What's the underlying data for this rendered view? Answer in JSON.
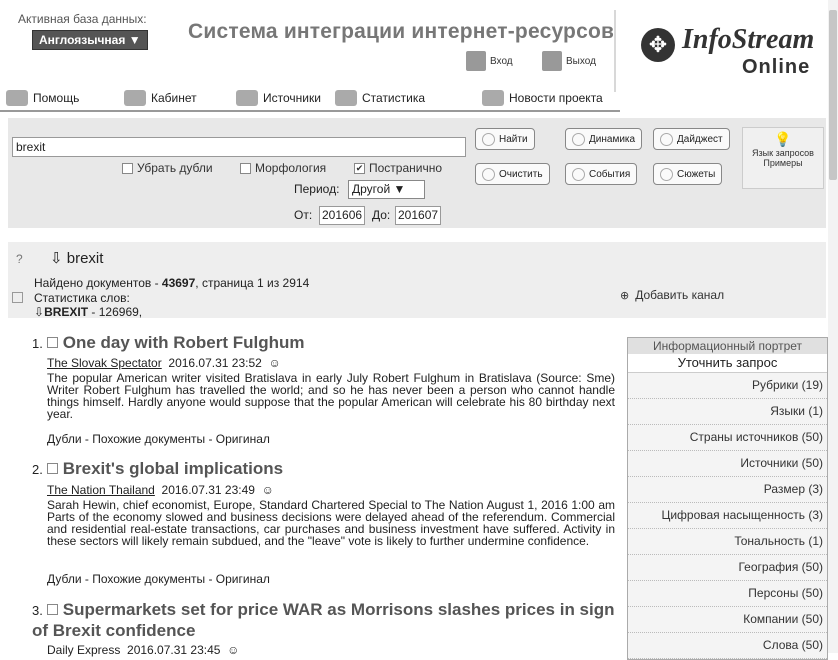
{
  "header": {
    "db_label": "Активная база данных:",
    "db_value": "Англоязычная ▼",
    "title": "Система интеграции интернет-ресурсов",
    "login": "Вход",
    "logout": "Выход",
    "logo_line1": "InfoStream",
    "logo_line2": "Online"
  },
  "nav": [
    "Помощь",
    "Кабинет",
    "Источники",
    "Статистика",
    "Новости проекта"
  ],
  "search": {
    "query": "brexit",
    "opt_dedup": "Убрать дубли",
    "opt_morph": "Морфология",
    "opt_paged": "Постранично",
    "paged_check": "✔",
    "period_label": "Период:",
    "period_value": "Другой ▼",
    "from_label": "От:",
    "from_value": "201606",
    "to_label": "До:",
    "to_value": "201607",
    "buttons": {
      "find": "Найти",
      "dynamics": "Динамика",
      "digest": "Дайджест",
      "clear": "Очистить",
      "events": "События",
      "plots": "Сюжеты"
    },
    "lang_help": "Язык запросов Примеры"
  },
  "results_header": {
    "query": "brexit",
    "found_prefix": "Найдено документов - ",
    "found_count": "43697",
    "found_suffix": ", страница 1 из 2914",
    "stats_label": "Статистика слов:",
    "word": "BREXIT",
    "word_count": " - 126969,",
    "add_channel": "Добавить канал"
  },
  "results": [
    {
      "num": "1.",
      "title": "One day with Robert Fulghum",
      "source": "The Slovak Spectator",
      "date": "2016.07.31 23:52",
      "snippet": "The popular American writer visited Bratislava in early July Robert Fulghum in Bratislava (Source: Sme) Writer Robert Fulghum has travelled the world; and so he has never been a person who cannot handle things himself. Hardly anyone would suppose that the popular American will celebrate his 80 birthday next year.",
      "links": "Дубли - Похожие документы - Оригинал"
    },
    {
      "num": "2.",
      "title": "Brexit's global implications",
      "source": "The Nation Thailand",
      "date": "2016.07.31 23:49",
      "snippet": "Sarah Hewin, chief economist, Europe, Standard Chartered Special to The Nation August 1, 2016 1:00 am Parts of the economy slowed and business decisions were delayed ahead of the referendum. Commercial and residential real-estate transactions, car purchases and business investment have suffered. Activity in these sectors will likely remain subdued, and the \"leave\" vote is likely to further undermine confidence.",
      "links": "Дубли - Похожие документы - Оригинал"
    },
    {
      "num": "3.",
      "title": "Supermarkets set for price WAR as Morrisons slashes prices in sign of Brexit confidence",
      "source": "Daily Express",
      "date": "2016.07.31 23:45"
    }
  ],
  "side": {
    "header": "Информационный портрет",
    "refine": "Уточнить запрос",
    "rows": [
      "Рубрики (19)",
      "Языки (1)",
      "Страны источников (50)",
      "Источники (50)",
      "Размер (3)",
      "Цифровая насыщенность (3)",
      "Тональность (1)",
      "География (50)",
      "Персоны (50)",
      "Компании (50)",
      "Слова (50)"
    ]
  }
}
